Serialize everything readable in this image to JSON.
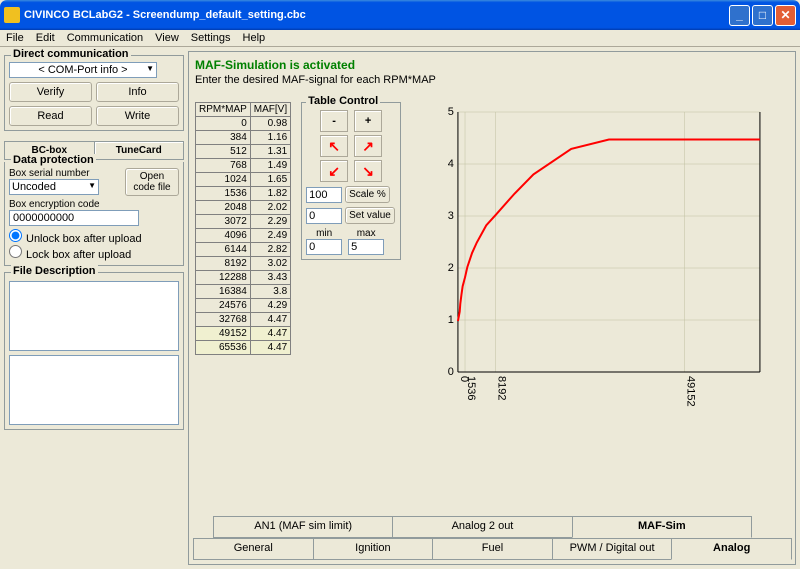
{
  "window_title": "CIVINCO  BCLabG2 - Screendump_default_setting.cbc",
  "menu": [
    "File",
    "Edit",
    "Communication",
    "View",
    "Settings",
    "Help"
  ],
  "dc": {
    "title": "Direct communication",
    "combo": "< COM-Port info >",
    "verify": "Verify",
    "info": "Info",
    "read": "Read",
    "write": "Write"
  },
  "tabs_small": {
    "bcbox": "BC-box",
    "tunecard": "TuneCard"
  },
  "dp": {
    "title": "Data protection",
    "serial_label": "Box serial number",
    "serial_val": "Uncoded",
    "open_code": "Open code file",
    "enc_label": "Box encryption code",
    "enc_val": "0000000000",
    "unlock": "Unlock box after upload",
    "lock": "Lock box after upload"
  },
  "fdesc_title": "File Description",
  "maf": {
    "title": "MAF-Simulation is activated",
    "sub": "Enter the desired MAF-signal for each RPM*MAP",
    "col1": "RPM*MAP",
    "col2": "MAF[V]",
    "rows": [
      [
        "0",
        "0.98"
      ],
      [
        "384",
        "1.16"
      ],
      [
        "512",
        "1.31"
      ],
      [
        "768",
        "1.49"
      ],
      [
        "1024",
        "1.65"
      ],
      [
        "1536",
        "1.82"
      ],
      [
        "2048",
        "2.02"
      ],
      [
        "3072",
        "2.29"
      ],
      [
        "4096",
        "2.49"
      ],
      [
        "6144",
        "2.82"
      ],
      [
        "8192",
        "3.02"
      ],
      [
        "12288",
        "3.43"
      ],
      [
        "16384",
        "3.8"
      ],
      [
        "24576",
        "4.29"
      ],
      [
        "32768",
        "4.47"
      ],
      [
        "49152",
        "4.47"
      ],
      [
        "65536",
        "4.47"
      ]
    ],
    "hl_rows": [
      15,
      16
    ]
  },
  "tc": {
    "title": "Table Control",
    "scale_val": "100",
    "scale_btn": "Scale %",
    "set_val": "0",
    "set_btn": "Set value",
    "min_label": "min",
    "min_val": "0",
    "max_label": "max",
    "max_val": "5"
  },
  "chart_data": {
    "type": "line",
    "x": [
      0,
      384,
      512,
      768,
      1024,
      1536,
      2048,
      3072,
      4096,
      6144,
      8192,
      12288,
      16384,
      24576,
      32768,
      49152,
      65536
    ],
    "y": [
      0.98,
      1.16,
      1.31,
      1.49,
      1.65,
      1.82,
      2.02,
      2.29,
      2.49,
      2.82,
      3.02,
      3.43,
      3.8,
      4.29,
      4.47,
      4.47,
      4.47
    ],
    "ylim": [
      0,
      5
    ],
    "yticks": [
      0,
      1,
      2,
      3,
      4,
      5
    ],
    "xticklabels": [
      "0",
      "1536",
      "8192",
      "49152"
    ],
    "xtickvals": [
      0,
      1536,
      8192,
      49152
    ]
  },
  "tabs_top": [
    "AN1 (MAF sim limit)",
    "Analog 2 out",
    "MAF-Sim"
  ],
  "tabs_top_active": 2,
  "tabs_bot": [
    "General",
    "Ignition",
    "Fuel",
    "PWM / Digital out",
    "Analog"
  ],
  "tabs_bot_active": 4
}
